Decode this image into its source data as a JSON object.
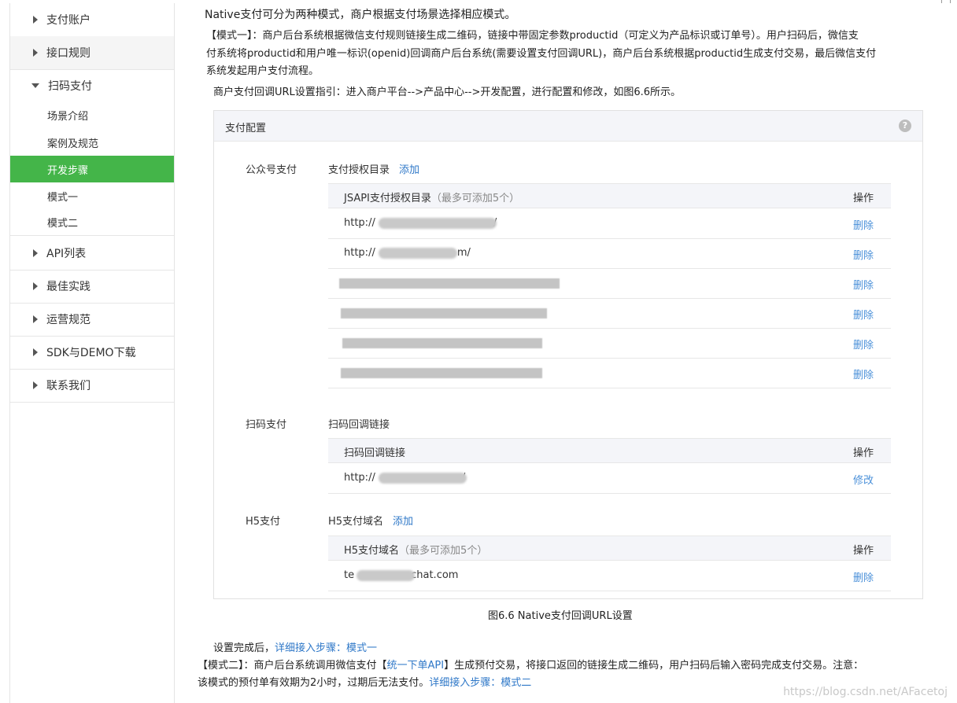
{
  "sidebar": {
    "items": [
      {
        "label": "支付账户"
      },
      {
        "label": "接口规则"
      },
      {
        "label": "扫码支付"
      },
      {
        "label": "API列表"
      },
      {
        "label": "最佳实践"
      },
      {
        "label": "运营规范"
      },
      {
        "label": "SDK与DEMO下载"
      },
      {
        "label": "联系我们"
      }
    ],
    "subitems": [
      {
        "label": "场景介绍"
      },
      {
        "label": "案例及规范"
      },
      {
        "label": "开发步骤"
      },
      {
        "label": "模式一"
      },
      {
        "label": "模式二"
      }
    ]
  },
  "article": {
    "intro": "Native支付可分为两种模式，商户根据支付场景选择相应模式。",
    "mode1_line1": "【模式一】：商户后台系统根据微信支付规则链接生成二维码，链接中带固定参数productid（可定义为产品标识或订单号）。用户扫码后，微信支",
    "mode1_line2": "付系统将productid和用户唯一标识(openid)回调商户后台系统(需要设置支付回调URL)，商户后台系统根据productid生成支付交易，最后微信支付",
    "mode1_line3": "系统发起用户支付流程。",
    "guide": "商户支付回调URL设置指引：进入商户平台-->产品中心-->开发配置，进行配置和修改，如图6.6所示。",
    "caption": "图6.6 Native支付回调URL设置",
    "after_prefix": "设置完成后，",
    "after_link": "详细接入步骤：模式一",
    "mode2_a": "【模式二】：商户后台系统调用微信支付【",
    "mode2_link": "统一下单API",
    "mode2_b": "】生成预付交易，将接口返回的链接生成二维码，用户扫码后输入密码完成支付交易。注意：",
    "mode2_line2": "该模式的预付单有效期为2小时，过期后无法支付。",
    "mode2_link2": "详细接入步骤：模式二"
  },
  "panel": {
    "title": "支付配置",
    "help_icon": "help-circle-icon",
    "help_glyph": "?",
    "jsapi": {
      "section": "公众号支付",
      "subtitle": "支付授权目录",
      "add": "添加",
      "col1": "JSAPI支付授权目录",
      "col1_note": "（最多可添加5个）",
      "col2": "操作",
      "rows": [
        {
          "text": "http://",
          "tail": "/",
          "action": "删除"
        },
        {
          "text": "http://",
          "tail": "m/",
          "action": "删除"
        },
        {
          "text": "",
          "tail": "",
          "action": "删除"
        },
        {
          "text": "",
          "tail": "",
          "action": "删除"
        },
        {
          "text": "",
          "tail": "",
          "action": "删除"
        },
        {
          "text": "",
          "tail": "",
          "action": "删除"
        }
      ]
    },
    "native": {
      "section": "扫码支付",
      "subtitle": "扫码回调链接",
      "col1": "扫码回调链接",
      "col2": "操作",
      "rows": [
        {
          "text": "http://",
          "tail": "/",
          "action": "修改"
        }
      ]
    },
    "h5": {
      "section": "H5支付",
      "subtitle": "H5支付域名",
      "add": "添加",
      "col1": "H5支付域名",
      "col1_note": "（最多可添加5个）",
      "col2": "操作",
      "rows": [
        {
          "text": "te",
          "tail": "chat.com",
          "action": "删除"
        }
      ]
    }
  },
  "watermark": "https://blog.csdn.net/AFacetoj",
  "colors": {
    "accent": "#44b549",
    "link": "#2f78c8"
  }
}
